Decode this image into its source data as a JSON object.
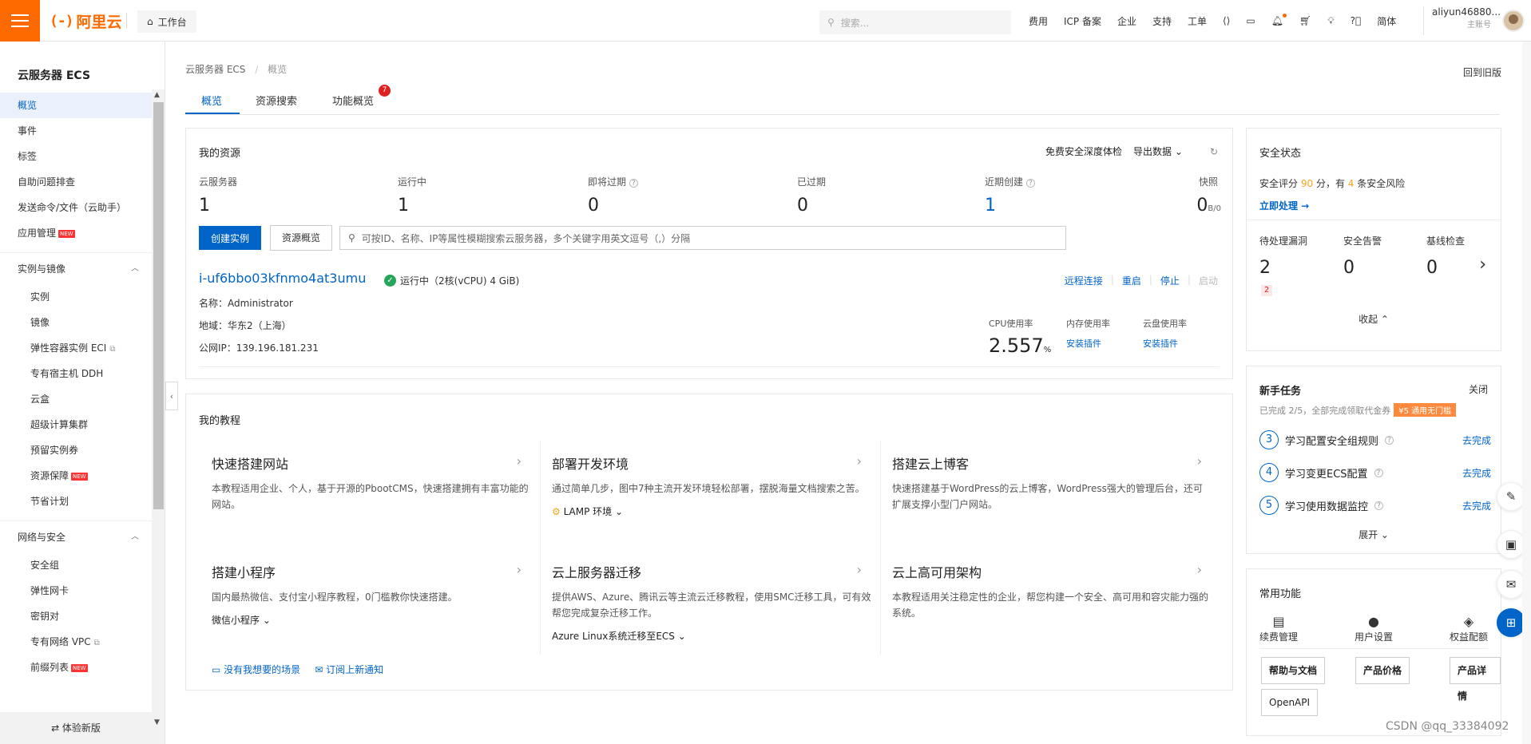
{
  "topbar": {
    "logo_text": "阿里云",
    "logo_mark": "(-)",
    "workbench": "工作台",
    "search_placeholder": "搜索...",
    "nav": [
      "费用",
      "ICP 备案",
      "企业",
      "支持",
      "工单"
    ],
    "lang": "简体",
    "account_name": "aliyun46880...",
    "account_role": "主账号",
    "icons": [
      "hamburger-icon",
      "home-icon",
      "search-icon",
      "code-icon",
      "terminal-icon",
      "bell-icon",
      "cart-icon",
      "bulb-icon",
      "help-icon"
    ],
    "brand_color": "#ff6a00"
  },
  "sidebar": {
    "title": "云服务器 ECS",
    "top_items": [
      {
        "label": "概览",
        "active": true
      },
      {
        "label": "事件"
      },
      {
        "label": "标签"
      },
      {
        "label": "自助问题排查"
      },
      {
        "label": "发送命令/文件（云助手）"
      },
      {
        "label": "应用管理",
        "new": true
      }
    ],
    "group1": {
      "label": "实例与镜像",
      "items": [
        {
          "label": "实例"
        },
        {
          "label": "镜像"
        },
        {
          "label": "弹性容器实例 ECI",
          "ext": true
        },
        {
          "label": "专有宿主机 DDH"
        },
        {
          "label": "云盒"
        },
        {
          "label": "超级计算集群"
        },
        {
          "label": "预留实例券"
        },
        {
          "label": "资源保障",
          "new": true
        },
        {
          "label": "节省计划"
        }
      ]
    },
    "group2": {
      "label": "网络与安全",
      "items": [
        {
          "label": "安全组"
        },
        {
          "label": "弹性网卡"
        },
        {
          "label": "密钥对"
        },
        {
          "label": "专有网络 VPC",
          "ext": true
        },
        {
          "label": "前缀列表",
          "new": true
        }
      ]
    },
    "new_tag": "NEW",
    "footer": "⇄ 体验新版"
  },
  "breadcrumb": {
    "root": "云服务器 ECS",
    "sep": "/",
    "current": "概览"
  },
  "old_version": "回到旧版",
  "tabs": [
    {
      "label": "概览",
      "active": true
    },
    {
      "label": "资源搜索"
    },
    {
      "label": "功能概览",
      "badge": "7"
    }
  ],
  "resources": {
    "title": "我的资源",
    "tool_scan": "免费安全深度体检",
    "tool_export": "导出数据",
    "stats": [
      {
        "label": "云服务器",
        "value": "1"
      },
      {
        "label": "运行中",
        "value": "1"
      },
      {
        "label": "即将过期",
        "value": "0",
        "help": true
      },
      {
        "label": "已过期",
        "value": "0"
      },
      {
        "label": "近期创建",
        "value": "1",
        "help": true,
        "blue": true
      },
      {
        "label": "快照",
        "value": "0",
        "unit": "B/0"
      }
    ],
    "btn_create": "创建实例",
    "btn_overview": "资源概览",
    "search_placeholder": "可按ID、名称、IP等属性模糊搜索云服务器，多个关键字用英文逗号（,）分隔",
    "instance": {
      "id": "i-uf6bbo03kfnmo4at3umu",
      "status": "运行中（2核(vCPU) 4 GiB)",
      "name_line": "名称：Administrator",
      "region_line": "地域：华东2（上海）",
      "ip_line": "公网IP：139.196.181.231",
      "actions": [
        "远程连接",
        "重启",
        "停止",
        "启动"
      ],
      "cpu_label": "CPU使用率",
      "cpu_value": "2.557",
      "cpu_unit": "%",
      "mem_label": "内存使用率",
      "mem_link": "安装插件",
      "disk_label": "云盘使用率",
      "disk_link": "安装插件"
    }
  },
  "tutorials": {
    "title": "我的教程",
    "items": [
      {
        "title": "快速搭建网站",
        "desc": "本教程适用企业、个人，基于开源的PbootCMS，快速搭建拥有丰富功能的网站。"
      },
      {
        "title": "部署开发环境",
        "desc": "通过简单几步，图中7种主流开发环境轻松部署，摆脱海量文档搜索之苦。",
        "option": "LAMP 环境"
      },
      {
        "title": "搭建云上博客",
        "desc": "快速搭建基于WordPress的云上博客，WordPress强大的管理后台，还可扩展支撑小型门户网站。"
      },
      {
        "title": "搭建小程序",
        "desc": "国内最热微信、支付宝小程序教程，0门槛教你快速搭建。",
        "option": "微信小程序"
      },
      {
        "title": "云上服务器迁移",
        "desc": "提供AWS、Azure、腾讯云等主流云迁移教程，使用SMC迁移工具，可有效帮您完成复杂迁移工作。",
        "option": "Azure Linux系统迁移至ECS"
      },
      {
        "title": "云上高可用架构",
        "desc": "本教程适用关注稳定性的企业，帮您构建一个安全、高可用和容灾能力强的系统。"
      }
    ],
    "foot_links": [
      "没有我想要的场景",
      "订阅上新通知"
    ]
  },
  "security": {
    "title": "安全状态",
    "score_pre": "安全评分",
    "score": "90",
    "score_mid": "分，有",
    "risks": "4",
    "score_post": "条安全风险",
    "link": "立即处理 →",
    "stats": [
      {
        "label": "待处理漏洞",
        "value": "2",
        "sub": "2"
      },
      {
        "label": "安全告警",
        "value": "0"
      },
      {
        "label": "基线检查",
        "value": "0"
      }
    ],
    "fold": "收起 ⌃"
  },
  "newbie": {
    "title": "新手任务",
    "close": "关闭",
    "progress": "已完成 2/5，全部完成领取代金券",
    "coupon": "¥5 通用无门槛",
    "tasks": [
      {
        "num": "3",
        "label": "学习配置安全组规则",
        "go": "去完成"
      },
      {
        "num": "4",
        "label": "学习变更ECS配置",
        "go": "去完成"
      },
      {
        "num": "5",
        "label": "学习使用数据监控",
        "go": "去完成"
      }
    ],
    "more": "展开 ⌄"
  },
  "common": {
    "title": "常用功能",
    "items": [
      {
        "label": "续费管理",
        "icon": "renew-icon"
      },
      {
        "label": "用户设置",
        "icon": "user-icon"
      },
      {
        "label": "权益配额",
        "icon": "quota-icon"
      }
    ],
    "buttons": [
      "帮助与文档",
      "产品价格",
      "产品详情",
      "OpenAPI"
    ]
  },
  "watermark": "CSDN @qq_33384092"
}
